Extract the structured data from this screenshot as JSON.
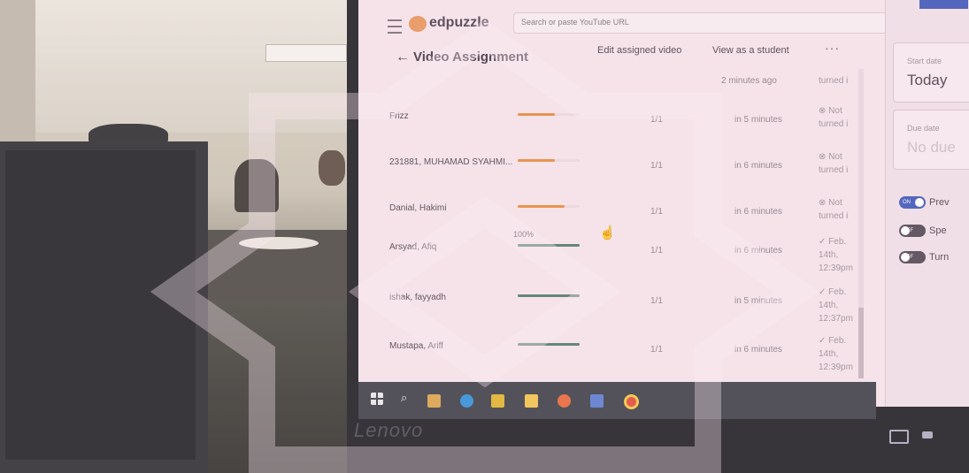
{
  "app": {
    "logo_text": "edpuzzle",
    "search_placeholder": "Search or paste YouTube URL",
    "colors": {
      "accent": "#3d56b8",
      "logo": "#e6945b",
      "progress_partial": "#e8893a",
      "progress_full": "#4f7a6a"
    }
  },
  "header": {
    "back_icon": "←",
    "title": "Video Assignment",
    "edit_label": "Edit assigned video",
    "view_label": "View as a student",
    "more_label": "···"
  },
  "students": [
    {
      "name": "Frizz",
      "progress": 0.6,
      "percent": "",
      "score": "1/1",
      "time": "in 5 minutes",
      "status_icon": "⊗",
      "status": "Not turned i",
      "complete": false
    },
    {
      "name": "231881, MUHAMAD SYAHMI...",
      "progress": 0.6,
      "percent": "",
      "score": "1/1",
      "time": "in 6 minutes",
      "status_icon": "⊗",
      "status": "Not turned i",
      "complete": false
    },
    {
      "name": "Danial, Hakimi",
      "progress": 0.75,
      "percent": "",
      "score": "1/1",
      "time": "in 6 minutes",
      "status_icon": "⊗",
      "status": "Not turned i",
      "complete": false
    },
    {
      "name": "Arsyad, Afiq",
      "progress": 1.0,
      "percent": "100%",
      "score": "1/1",
      "time": "in 6 minutes",
      "status_icon": "✓",
      "status": "Feb. 14th, 12:39pm",
      "complete": true
    },
    {
      "name": "ishak, fayyadh",
      "progress": 1.0,
      "percent": "",
      "score": "1/1",
      "time": "in 5 minutes",
      "status_icon": "✓",
      "status": "Feb. 14th, 12:37pm",
      "complete": true
    },
    {
      "name": "Mustapa, Ariff",
      "progress": 1.0,
      "percent": "",
      "score": "1/1",
      "time": "in 6 minutes",
      "status_icon": "✓",
      "status": "Feb. 14th, 12:39pm",
      "complete": true
    }
  ],
  "partial_row": {
    "time": "2 minutes ago",
    "status": "turned i"
  },
  "side_panel": {
    "start_label": "Start date",
    "start_value": "Today",
    "due_label": "Due date",
    "due_value": "No due",
    "toggles": [
      {
        "state_label": "ON",
        "label": "Prev",
        "on": true
      },
      {
        "state_label": "OFF",
        "label": "Spe",
        "on": false
      },
      {
        "state_label": "OFF",
        "label": "Turn",
        "on": false
      }
    ]
  },
  "taskbar": {
    "icons": [
      "windows-icon",
      "search-icon",
      "store-icon",
      "edge-icon",
      "sticky-icon",
      "folder-icon",
      "firefox-icon",
      "dev-icon",
      "chrome-icon"
    ]
  },
  "bezel": {
    "brand": "Lenovo"
  }
}
